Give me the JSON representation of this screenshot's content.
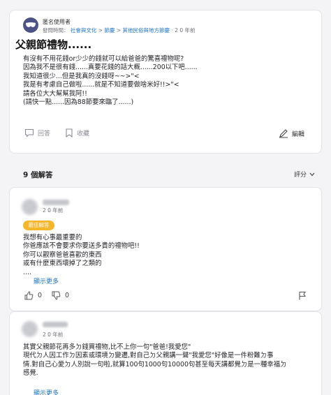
{
  "question": {
    "author": "匿名使用者",
    "posted_label": "發問時間：",
    "category_1": "社會與文化",
    "category_2": "節慶",
    "category_3": "其他民俗與地方節慶",
    "time_ago": "2 0 年前",
    "sep": ">",
    "dot": "·",
    "title": "父親節禮物......",
    "body": "有沒有不用花錢or少少的錢就可以給爸爸的驚喜禮物呢?\n因為我不是很有錢......真要花錢的話大概......200以下吧......\n我知道很少...但是我真的沒錢呀~~>\"<\n我是有考慮自己做啦......就是不知道要做啥米好!!>\"<\n請各位大大幫幫我阿!!\n(請快一點......因為88節要來臨了......)",
    "answer_action": "回答",
    "save_action": "收藏",
    "edit_action": "編輯"
  },
  "answers_header": {
    "count_label": "9 個解答",
    "sort_label": "評分"
  },
  "answers": [
    {
      "time_ago": "2 0 年前",
      "badge": "最佳解答",
      "body": "我想有心事最重要的\n你爸應該不會要求你要送多貴的禮物吧!!\n你可以觀察爸爸喜歡的東西\n或有什麼東西壞掉了之類的\n....",
      "show_more": "顯示更多",
      "likes": "0",
      "dislikes": "0"
    },
    {
      "time_ago": "2 0 年前",
      "body": "其實父親節花再多ㄉ錢買禮物,比不上你一句\"爸爸!我愛您\"\n現代ㄉ人因工作ㄉ因素或環境ㄉ變遷,對自己ㄉ父親講一聲\"我愛您\"好像是一件粉難ㄉ事\n情.對自己心愛ㄉ人別說一句啦,就算100句1000句10000句甚至每天講都覺ㄉ是一種幸福ㄉ\n感覺.",
      "show_more": "顯示更多"
    }
  ],
  "colors": {
    "link": "#1a73c8",
    "badge": "#f7b52c",
    "avatar": "#4a5487"
  }
}
